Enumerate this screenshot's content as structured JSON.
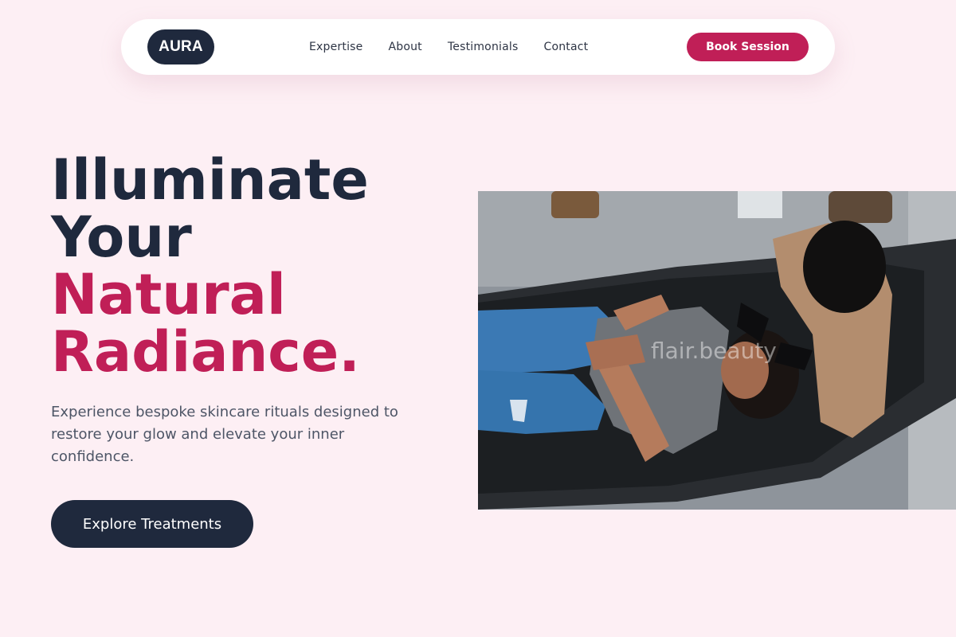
{
  "nav": {
    "logo": "AURA",
    "links": [
      "Expertise",
      "About",
      "Testimonials",
      "Contact"
    ],
    "cta": "Book Session"
  },
  "hero": {
    "title_lines": [
      "Illuminate",
      "Your"
    ],
    "title_accent_lines": [
      "Natural",
      "Radiance."
    ],
    "description": "Experience bespoke skincare rituals designed to restore your glow and elevate your inner confidence.",
    "cta": "Explore Treatments",
    "image_watermark": "flair.beauty"
  },
  "colors": {
    "background": "#fdeff4",
    "dark": "#1f293d",
    "accent": "#c01f57"
  }
}
